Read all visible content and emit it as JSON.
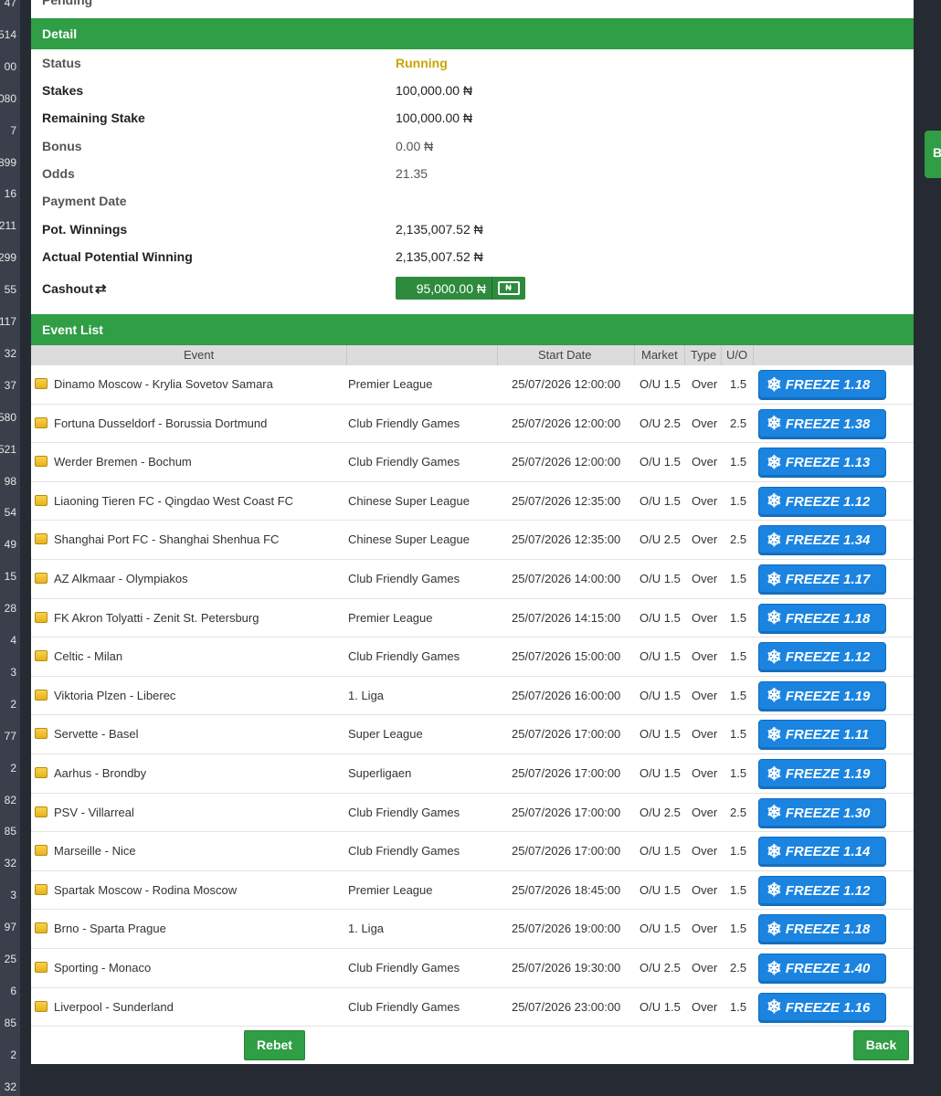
{
  "left_strip": [
    "47",
    "514",
    "00",
    "080",
    "7",
    "899",
    "16",
    "211",
    "299",
    "55",
    "117",
    "32",
    "37",
    "580",
    "521",
    "98",
    "54",
    "49",
    "15",
    "28",
    "4",
    "3",
    "2",
    "77",
    "2",
    "82",
    "85",
    "32",
    "3",
    "97",
    "25",
    "6",
    "85",
    "2",
    "32"
  ],
  "right_tab": {
    "label": "B"
  },
  "modal": {
    "pending_label": "Pending",
    "detail_title": "Detail",
    "details": {
      "status": {
        "label": "Status",
        "value": "Running"
      },
      "stakes": {
        "label": "Stakes",
        "value": "100,000.00 ₦"
      },
      "remaining_stake": {
        "label": "Remaining Stake",
        "value": "100,000.00 ₦"
      },
      "bonus": {
        "label": "Bonus",
        "value": "0.00 ₦"
      },
      "odds": {
        "label": "Odds",
        "value": "21.35"
      },
      "payment_date": {
        "label": "Payment Date",
        "value": ""
      },
      "pot_winnings": {
        "label": "Pot. Winnings",
        "value": "2,135,007.52 ₦"
      },
      "actual_potential_winning": {
        "label": "Actual Potential Winning",
        "value": "2,135,007.52 ₦"
      },
      "cashout": {
        "label": "Cashout",
        "value": "95,000.00 ₦",
        "icon": "cash-note-icon",
        "icon_label": "₦"
      }
    },
    "event_list_title": "Event List",
    "columns": {
      "event": "Event",
      "start_date": "Start Date",
      "market": "Market",
      "type": "Type",
      "uo": "U/O"
    },
    "freeze_label": "FREEZE",
    "events": [
      {
        "event": "Dinamo Moscow - Krylia Sovetov Samara",
        "league": "Premier League",
        "start": "25/07/2026 12:00:00",
        "market": "O/U 1.5",
        "type": "Over",
        "uo": "1.5",
        "freeze": "FREEZE 1.18"
      },
      {
        "event": "Fortuna Dusseldorf - Borussia Dortmund",
        "league": "Club Friendly Games",
        "start": "25/07/2026 12:00:00",
        "market": "O/U 2.5",
        "type": "Over",
        "uo": "2.5",
        "freeze": "FREEZE 1.38"
      },
      {
        "event": "Werder Bremen - Bochum",
        "league": "Club Friendly Games",
        "start": "25/07/2026 12:00:00",
        "market": "O/U 1.5",
        "type": "Over",
        "uo": "1.5",
        "freeze": "FREEZE 1.13"
      },
      {
        "event": "Liaoning Tieren FC - Qingdao West Coast FC",
        "league": "Chinese Super League",
        "start": "25/07/2026 12:35:00",
        "market": "O/U 1.5",
        "type": "Over",
        "uo": "1.5",
        "freeze": "FREEZE 1.12"
      },
      {
        "event": "Shanghai Port FC - Shanghai Shenhua FC",
        "league": "Chinese Super League",
        "start": "25/07/2026 12:35:00",
        "market": "O/U 2.5",
        "type": "Over",
        "uo": "2.5",
        "freeze": "FREEZE 1.34"
      },
      {
        "event": "AZ Alkmaar - Olympiakos",
        "league": "Club Friendly Games",
        "start": "25/07/2026 14:00:00",
        "market": "O/U 1.5",
        "type": "Over",
        "uo": "1.5",
        "freeze": "FREEZE 1.17"
      },
      {
        "event": "FK Akron Tolyatti - Zenit St. Petersburg",
        "league": "Premier League",
        "start": "25/07/2026 14:15:00",
        "market": "O/U 1.5",
        "type": "Over",
        "uo": "1.5",
        "freeze": "FREEZE 1.18"
      },
      {
        "event": "Celtic - Milan",
        "league": "Club Friendly Games",
        "start": "25/07/2026 15:00:00",
        "market": "O/U 1.5",
        "type": "Over",
        "uo": "1.5",
        "freeze": "FREEZE 1.12"
      },
      {
        "event": "Viktoria Plzen - Liberec",
        "league": "1. Liga",
        "start": "25/07/2026 16:00:00",
        "market": "O/U 1.5",
        "type": "Over",
        "uo": "1.5",
        "freeze": "FREEZE 1.19"
      },
      {
        "event": "Servette - Basel",
        "league": "Super League",
        "start": "25/07/2026 17:00:00",
        "market": "O/U 1.5",
        "type": "Over",
        "uo": "1.5",
        "freeze": "FREEZE 1.11"
      },
      {
        "event": "Aarhus - Brondby",
        "league": "Superligaen",
        "start": "25/07/2026 17:00:00",
        "market": "O/U 1.5",
        "type": "Over",
        "uo": "1.5",
        "freeze": "FREEZE 1.19"
      },
      {
        "event": "PSV - Villarreal",
        "league": "Club Friendly Games",
        "start": "25/07/2026 17:00:00",
        "market": "O/U 2.5",
        "type": "Over",
        "uo": "2.5",
        "freeze": "FREEZE 1.30"
      },
      {
        "event": "Marseille - Nice",
        "league": "Club Friendly Games",
        "start": "25/07/2026 17:00:00",
        "market": "O/U 1.5",
        "type": "Over",
        "uo": "1.5",
        "freeze": "FREEZE 1.14"
      },
      {
        "event": "Spartak Moscow - Rodina Moscow",
        "league": "Premier League",
        "start": "25/07/2026 18:45:00",
        "market": "O/U 1.5",
        "type": "Over",
        "uo": "1.5",
        "freeze": "FREEZE 1.12"
      },
      {
        "event": "Brno - Sparta Prague",
        "league": "1. Liga",
        "start": "25/07/2026 19:00:00",
        "market": "O/U 1.5",
        "type": "Over",
        "uo": "1.5",
        "freeze": "FREEZE 1.18"
      },
      {
        "event": "Sporting - Monaco",
        "league": "Club Friendly Games",
        "start": "25/07/2026 19:30:00",
        "market": "O/U 2.5",
        "type": "Over",
        "uo": "2.5",
        "freeze": "FREEZE 1.40"
      },
      {
        "event": "Liverpool - Sunderland",
        "league": "Club Friendly Games",
        "start": "25/07/2026 23:00:00",
        "market": "O/U 1.5",
        "type": "Over",
        "uo": "1.5",
        "freeze": "FREEZE 1.16"
      }
    ],
    "rebet_label": "Rebet",
    "back_label": "Back"
  },
  "colors": {
    "accent_green": "#2f9e44",
    "status_running": "#c9a400",
    "freeze_blue": "#1b84e0"
  }
}
